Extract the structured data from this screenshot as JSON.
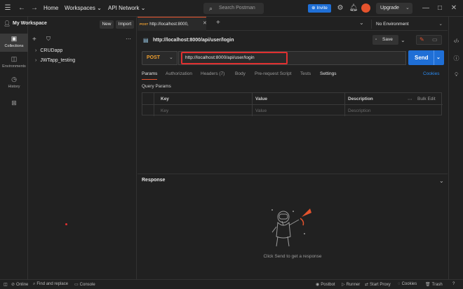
{
  "topbar": {
    "menu_icon": "hamburger-icon",
    "back_icon": "arrow-left-icon",
    "forward_icon": "arrow-right-icon",
    "home": "Home",
    "workspaces": "Workspaces",
    "api_network": "API Network",
    "search_placeholder": "Search Postman",
    "invite": "Invite",
    "upgrade": "Upgrade"
  },
  "rail": {
    "items": [
      {
        "label": "Collections",
        "icon": "collections-icon"
      },
      {
        "label": "Environments",
        "icon": "environments-icon"
      },
      {
        "label": "History",
        "icon": "history-icon"
      },
      {
        "label": "",
        "icon": "apps-icon"
      }
    ]
  },
  "sidebar": {
    "workspace_title": "My Workspace",
    "new_button": "New",
    "import_button": "Import",
    "collections": [
      {
        "label": "CRUDapp"
      },
      {
        "label": "JWTapp_testing"
      }
    ]
  },
  "tabs": {
    "request_tab_method": "POST",
    "request_tab_label": "http://localhost:8000,",
    "environment": "No Environment"
  },
  "request": {
    "title": "http://localhost:8000/api/user/login",
    "save": "Save",
    "method": "POST",
    "url": "http://localhost:8000/api/user/login",
    "send": "Send",
    "subtabs": [
      "Params",
      "Authorization",
      "Headers (7)",
      "Body",
      "Pre-request Script",
      "Tests",
      "Settings"
    ],
    "cookies": "Cookies",
    "query_params_title": "Query Params",
    "table": {
      "headers": [
        "Key",
        "Value",
        "Description"
      ],
      "bulk_edit": "Bulk Edit",
      "placeholders": [
        "Key",
        "Value",
        "Description"
      ]
    }
  },
  "response": {
    "title": "Response",
    "empty_message": "Click Send to get a response"
  },
  "statusbar": {
    "online": "Online",
    "find_replace": "Find and replace",
    "console": "Console",
    "postbot": "Postbot",
    "runner": "Runner",
    "start_proxy": "Start Proxy",
    "cookies": "Cookies",
    "trash": "Trash"
  },
  "colors": {
    "accent": "#e5532d",
    "primary_blue": "#1f6fd6",
    "highlight_red": "#e03030",
    "background": "#212121"
  }
}
